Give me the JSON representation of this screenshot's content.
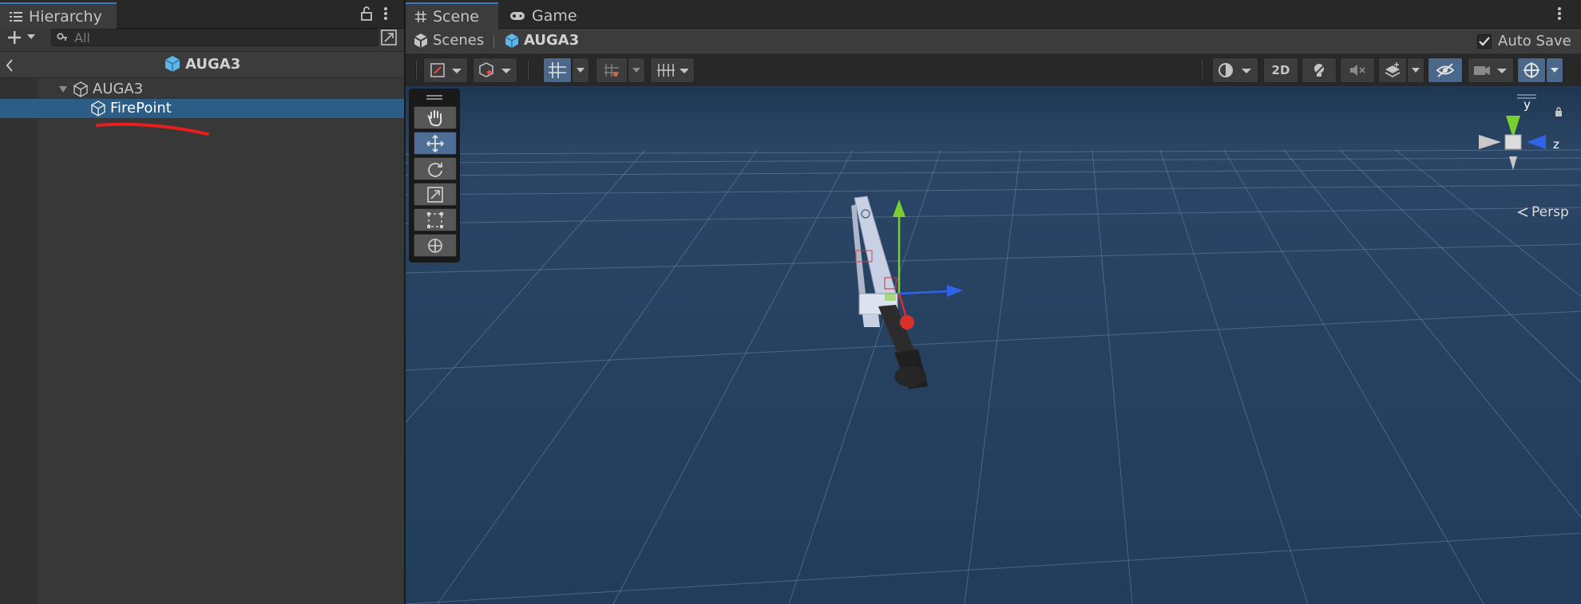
{
  "hierarchy": {
    "tab_label": "Hierarchy",
    "search_placeholder": "All",
    "scene_name": "AUGA3",
    "items": [
      {
        "label": "AUGA3"
      },
      {
        "label": "FirePoint"
      }
    ]
  },
  "scene_view": {
    "tabs": [
      {
        "label": "Scene"
      },
      {
        "label": "Game"
      }
    ],
    "breadcrumb": {
      "root": "Scenes",
      "current": "AUGA3"
    },
    "auto_save_label": "Auto Save",
    "auto_save_checked": true,
    "toggle_2d_label": "2D",
    "projection_label": "Persp",
    "gizmo_axes": {
      "y": "y",
      "z": "z"
    }
  },
  "colors": {
    "accent": "#3a79bb",
    "selection": "#2c5d87",
    "sky": "#233d5a",
    "axis_x": "#d9302c",
    "axis_y": "#79cf32",
    "axis_z": "#2f63e8",
    "annotation": "#e81d1d"
  }
}
